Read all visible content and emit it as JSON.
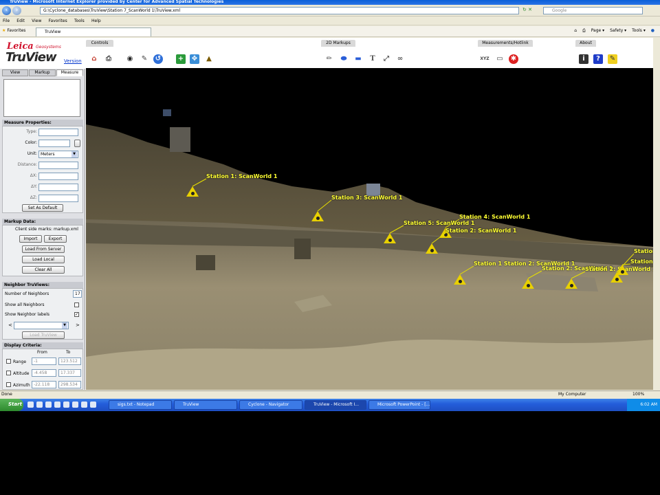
{
  "browser": {
    "title": "TruView - Microsoft Internet Explorer provided by Center for Advanced Spatial Technologies",
    "address": "G:\\Cyclone_databases\\TruView\\Station 7_ScanWorld 1\\TruView.xml",
    "search_placeholder": "Google",
    "menu": [
      "File",
      "Edit",
      "View",
      "Favorites",
      "Tools",
      "Help"
    ],
    "favorites_label": "Favorites",
    "tab_label": "TruView",
    "tools": [
      "Page ▾",
      "Safety ▾",
      "Tools ▾"
    ],
    "status_left": "Done",
    "status_zone": "My Computer",
    "zoom": "100%"
  },
  "app": {
    "logo": {
      "brand": "Leica",
      "sub": "Geosystems",
      "product": "TruView",
      "version_link": "Version"
    },
    "panel_tabs": [
      "View",
      "Markup",
      "Measure"
    ],
    "measure_properties": {
      "header": "Measure Properties:",
      "type_label": "Type:",
      "color_label": "Color:",
      "unit_label": "Unit:",
      "unit_value": "Meters",
      "distance_label": "Distance:",
      "dx_label": "ΔX:",
      "dy_label": "ΔY:",
      "dz_label": "ΔZ:",
      "default_button": "Set As Default"
    },
    "markup_data": {
      "header": "Markup Data:",
      "note": "Client side marks: markup.xml",
      "import": "Import",
      "export": "Export",
      "load_server": "Load From Server",
      "load_local": "Load Local",
      "clear_all": "Clear All"
    },
    "neighbor": {
      "header": "Neighbor TruViews:",
      "count_label": "Number of Neighbors",
      "count_value": "17",
      "show_all": "Show all Neighbors",
      "show_labels": "Show Neighbor labels",
      "prev": "<",
      "next": ">",
      "load_button": "Load TruView"
    },
    "display": {
      "header": "Display Criteria:",
      "from": "From",
      "to": "To",
      "range_label": "Range",
      "range_from": "-1",
      "range_to": "123.512",
      "altitude_label": "Altitude",
      "altitude_from": "-4.458",
      "altitude_to": "17.337",
      "azimuth_label": "Azimuth",
      "azimuth_from": "-22.118",
      "azimuth_to": "298.534"
    },
    "toolbar_groups": {
      "controls": "Controls",
      "markups": "2D Markups",
      "measure": "Measurements/Hotlink",
      "about": "About"
    },
    "markers": [
      {
        "label": "Station 1: ScanWorld 1"
      },
      {
        "label": "Station 3: ScanWorld 1"
      },
      {
        "label": "Station 4: ScanWorld 1"
      },
      {
        "label": "Station 5: ScanWorld 1"
      },
      {
        "label": "Station 2: ScanWorld 1"
      },
      {
        "label": "Station 1 Station 2: ScanWorld 1"
      },
      {
        "label": "Station 2: ScanWorld 1"
      },
      {
        "label": "Station 2: ScanWorld 1"
      },
      {
        "label": "Station"
      },
      {
        "label": "Station"
      }
    ]
  },
  "taskbar": {
    "start": "Start",
    "tasks": [
      "sigs.txt - Notepad",
      "TruView",
      "Cyclone - Navigator",
      "TruView - Microsoft I...",
      "Microsoft PowerPoint - [..."
    ],
    "clock": "6:02 AM"
  }
}
